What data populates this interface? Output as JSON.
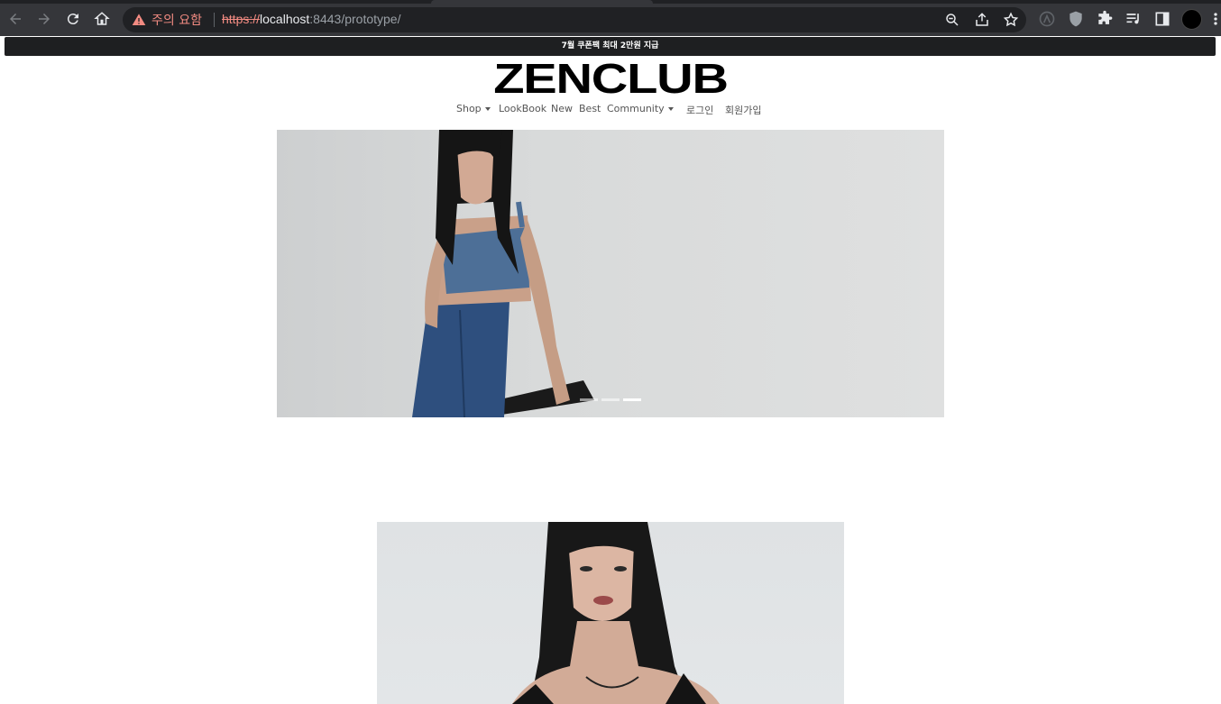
{
  "browser": {
    "security_warning": "주의 요함",
    "url_scheme": "https://",
    "url_host": "localhost",
    "url_rest": ":8443/prototype/"
  },
  "announcement": "7월 쿠폰팩 최대 2만원 지급",
  "logo": "ZENCLUB",
  "menu": {
    "shop": "Shop",
    "lookbook": "LookBook",
    "new": "New",
    "best": "Best",
    "community": "Community",
    "login": "로그인",
    "signup": "회원가입"
  },
  "carousel": {
    "slide_count": 3,
    "active_index": 3
  },
  "colors": {
    "announcement_bg": "#1e1f21",
    "chrome_bg": "#35363a",
    "warning": "#f28b82"
  }
}
